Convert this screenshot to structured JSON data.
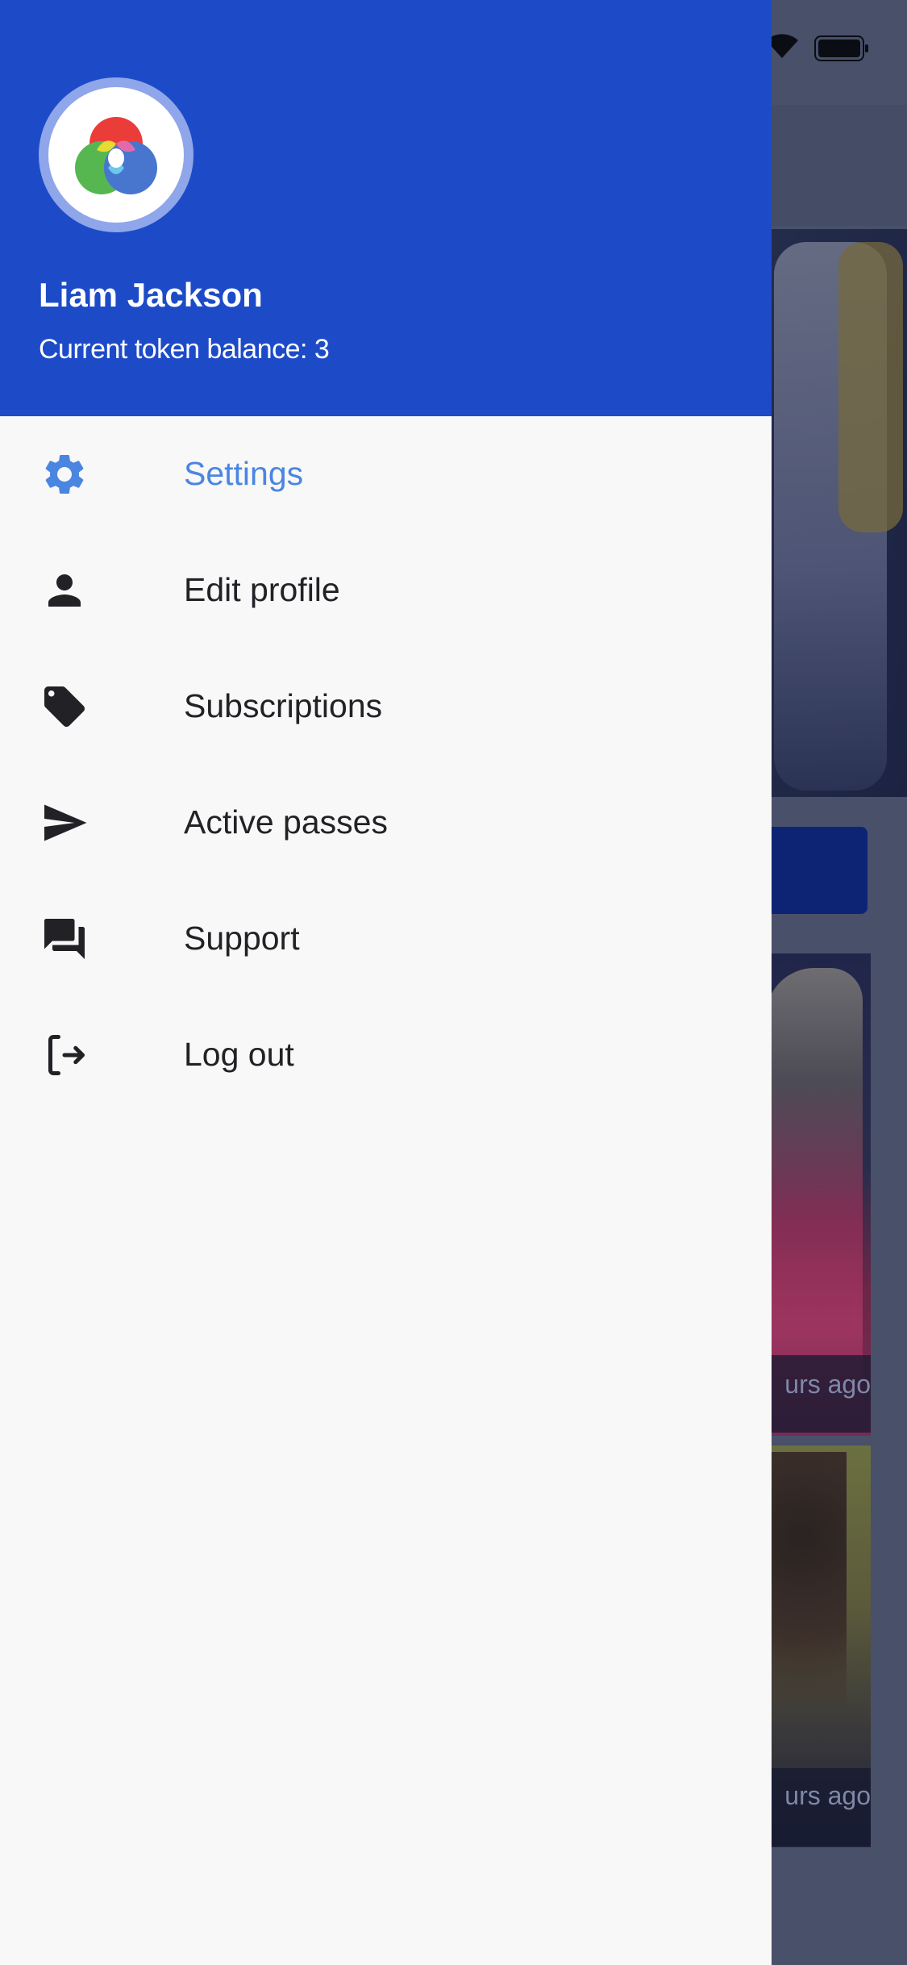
{
  "drawer": {
    "user_name": "Liam Jackson",
    "token_balance": "Current token balance: 3",
    "menu": [
      {
        "label": "Settings",
        "icon": "gear-icon",
        "active": true
      },
      {
        "label": "Edit profile",
        "icon": "person-icon",
        "active": false
      },
      {
        "label": "Subscriptions",
        "icon": "tag-icon",
        "active": false
      },
      {
        "label": "Active passes",
        "icon": "send-icon",
        "active": false
      },
      {
        "label": "Support",
        "icon": "forum-icon",
        "active": false
      },
      {
        "label": "Log out",
        "icon": "logout-icon",
        "active": false
      }
    ]
  },
  "background": {
    "timestamps": [
      "urs ago",
      "urs ago"
    ]
  },
  "colors": {
    "header_blue": "#1d4bc8",
    "active_item": "#4a86e0",
    "drawer_bg": "#f8f8f8"
  }
}
